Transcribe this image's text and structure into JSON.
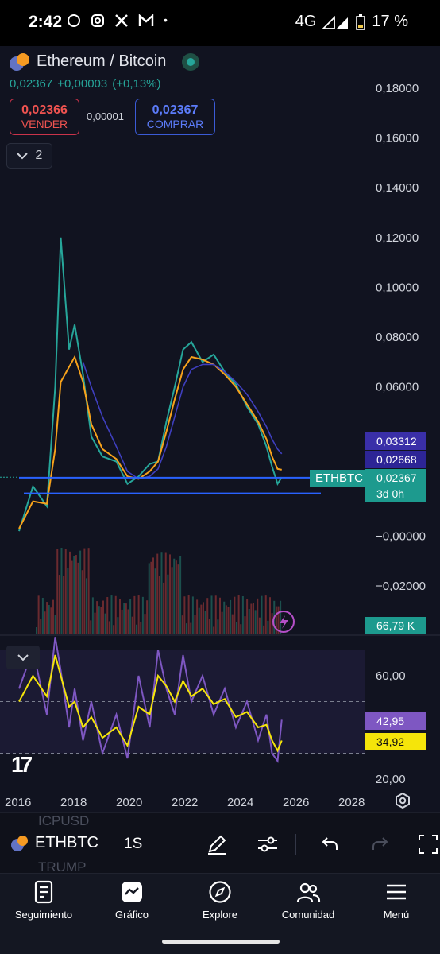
{
  "status_bar": {
    "time": "2:42",
    "network": "4G",
    "battery": "17 %"
  },
  "symbol": {
    "title": "Ethereum / Bitcoin",
    "last": "0,02367",
    "change": "+0,00003",
    "change_pct": "(+0,13%)"
  },
  "trade": {
    "sell_price": "0,02366",
    "sell_label": "VENDER",
    "spread": "0,00001",
    "buy_price": "0,02367",
    "buy_label": "COMPRAR"
  },
  "indicators_toggle": {
    "count": "2"
  },
  "price_axis": [
    "0,18000",
    "0,16000",
    "0,14000",
    "0,12000",
    "0,10000",
    "0,08000",
    "0,06000",
    "−0,00000",
    "−0,02000"
  ],
  "price_tags": {
    "ma_slow": "0,03312",
    "ma_fast": "0,02668",
    "last_price": "0,02367",
    "countdown": "3d 0h",
    "symbol_tag": "ETHBTC",
    "volume": "66,79 K"
  },
  "rsi_axis": [
    "60,00",
    "20,00"
  ],
  "rsi_tags": {
    "rsi": "42,95",
    "rsi_ma": "34,92"
  },
  "time_axis": [
    "2016",
    "2018",
    "2020",
    "2022",
    "2024",
    "2026",
    "2028"
  ],
  "toolbar": {
    "symbol": "ETHBTC",
    "interval": "1S",
    "ghost_top": "ICPUSD",
    "ghost_bottom": "TRUMP"
  },
  "nav": [
    "Seguimiento",
    "Gráfico",
    "Explore",
    "Comunidad",
    "Menú"
  ],
  "colors": {
    "up": "#26a69a",
    "down": "#ef5350",
    "ma_fast": "#f7a21b",
    "ma_slow": "#3f3fbf",
    "rsi_line": "#7e57c2",
    "rsi_ma": "#f5e50a",
    "hline": "#2962ff"
  },
  "chart_data": {
    "type": "line",
    "price_series_name": "ETHBTC",
    "x": [
      2016.0,
      2016.5,
      2017.0,
      2017.3,
      2017.5,
      2017.8,
      2018.0,
      2018.3,
      2018.6,
      2019.0,
      2019.5,
      2019.9,
      2020.3,
      2020.7,
      2021.0,
      2021.3,
      2021.6,
      2021.9,
      2022.2,
      2022.6,
      2023.0,
      2023.4,
      2023.8,
      2024.2,
      2024.6,
      2024.9,
      2025.1,
      2025.3,
      2025.45
    ],
    "price": [
      0.002,
      0.02,
      0.012,
      0.06,
      0.12,
      0.075,
      0.085,
      0.065,
      0.04,
      0.032,
      0.03,
      0.021,
      0.024,
      0.029,
      0.03,
      0.046,
      0.06,
      0.075,
      0.078,
      0.07,
      0.073,
      0.066,
      0.061,
      0.052,
      0.045,
      0.036,
      0.028,
      0.021,
      0.0237
    ],
    "ma_fast": [
      0.003,
      0.014,
      0.013,
      0.035,
      0.062,
      0.068,
      0.072,
      0.062,
      0.045,
      0.035,
      0.031,
      0.024,
      0.023,
      0.026,
      0.03,
      0.042,
      0.055,
      0.067,
      0.072,
      0.071,
      0.069,
      0.065,
      0.06,
      0.053,
      0.046,
      0.039,
      0.032,
      0.027,
      0.0267
    ],
    "ma_slow": [
      null,
      null,
      null,
      null,
      null,
      null,
      null,
      0.07,
      0.06,
      0.048,
      0.036,
      0.026,
      0.023,
      0.024,
      0.027,
      0.036,
      0.048,
      0.06,
      0.067,
      0.069,
      0.069,
      0.066,
      0.062,
      0.057,
      0.05,
      0.044,
      0.039,
      0.035,
      0.0331
    ],
    "hlines": [
      0.0235,
      0.0172
    ],
    "rsi": [
      55,
      70,
      45,
      75,
      62,
      40,
      55,
      35,
      50,
      30,
      45,
      28,
      60,
      40,
      70,
      55,
      45,
      68,
      50,
      60,
      45,
      55,
      40,
      50,
      35,
      45,
      30,
      27,
      42.95
    ],
    "rsi_ma": [
      50,
      60,
      52,
      68,
      60,
      48,
      50,
      40,
      44,
      36,
      40,
      33,
      48,
      45,
      60,
      56,
      50,
      58,
      52,
      55,
      49,
      51,
      44,
      46,
      40,
      41,
      35,
      31,
      34.92
    ],
    "ylim": [
      -0.025,
      0.19
    ],
    "rsi_levels": [
      70,
      50,
      30
    ]
  }
}
